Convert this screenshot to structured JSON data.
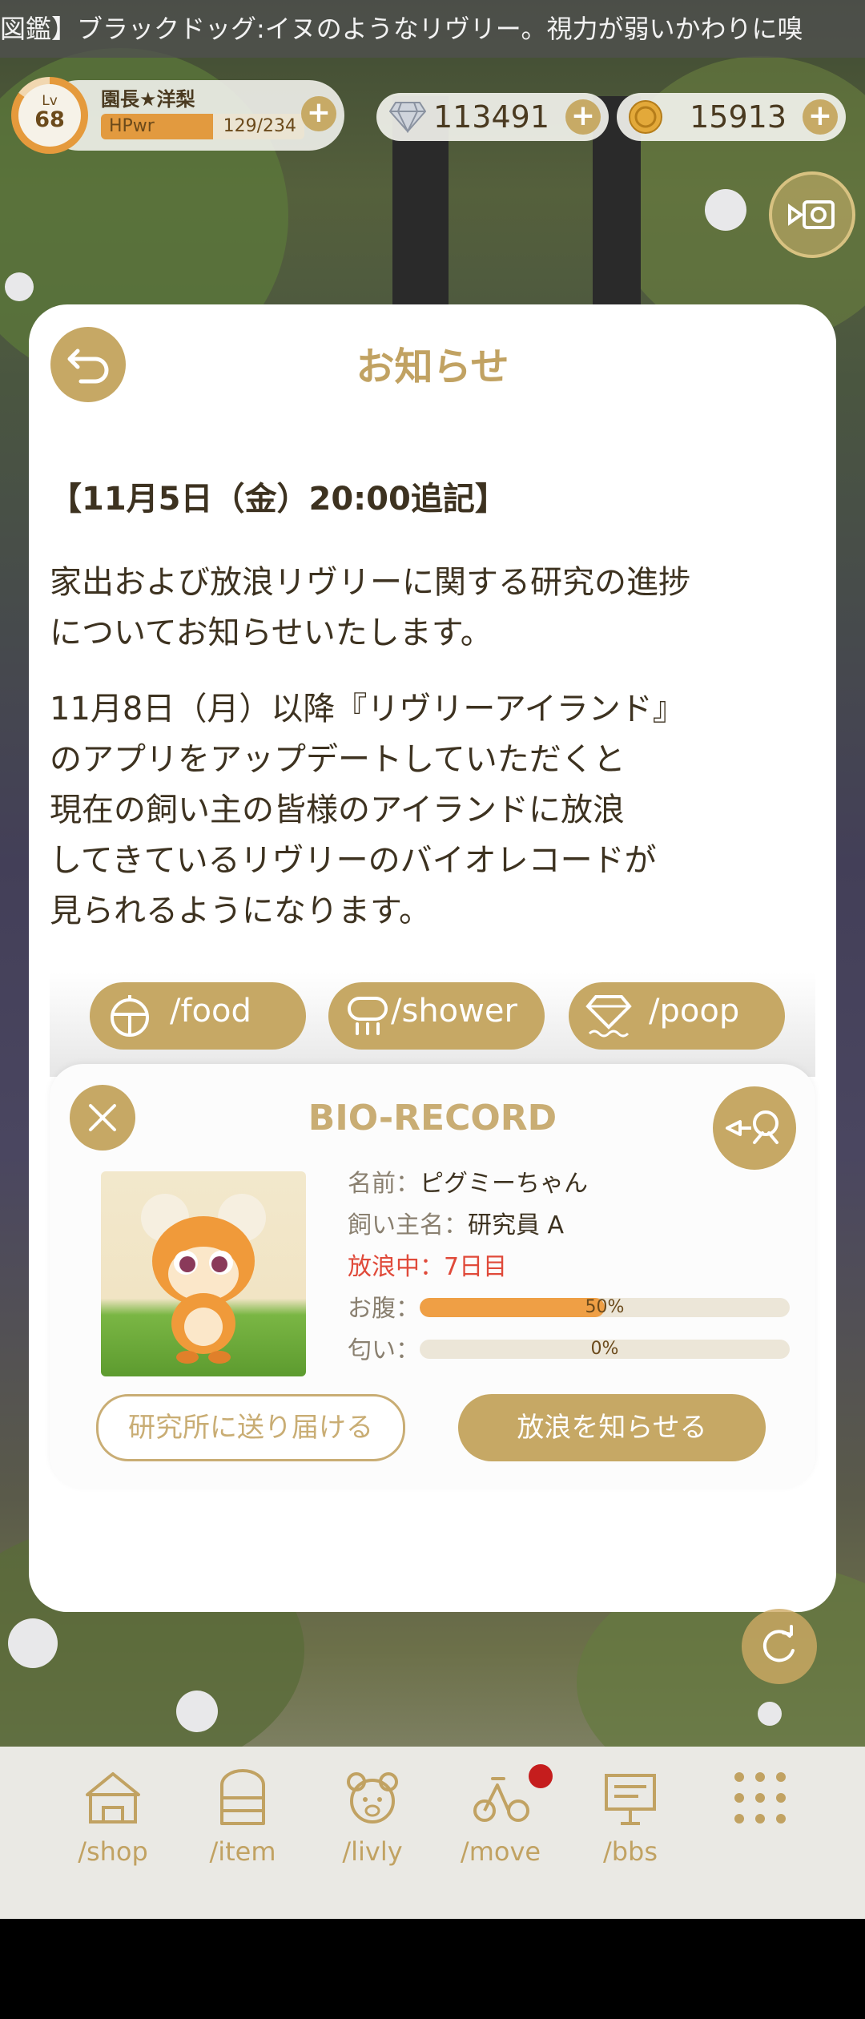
{
  "ticker": {
    "text": "図鑑】ブラックドッグ:イヌのようなリヴリー。視力が弱いかわりに嗅"
  },
  "player": {
    "level_label": "Lv",
    "level": "68",
    "name": "園長★洋梨",
    "hp_label": "HPwr",
    "hp_value": "129/234",
    "hp_fraction": 0.55
  },
  "currency": {
    "gems": "113491",
    "coins": "15913"
  },
  "modal": {
    "title": "お知らせ",
    "heading": "【11月5日（金）20:00追記】",
    "para1_line1": "家出および放浪リヴリーに関する研究の進捗",
    "para1_line2": "についてお知らせいたします。",
    "para2_line1": "11月8日（月）以降『リヴリーアイランド』",
    "para2_line2": "のアプリをアップデートしていただくと",
    "para2_line3": "現在の飼い主の皆様のアイランドに放浪",
    "para2_line4": "してきているリヴリーのバイオレコードが",
    "para2_line5": "見られるようになります。"
  },
  "actions": {
    "food": "/food",
    "shower": "/shower",
    "poop": "/poop"
  },
  "bio_record": {
    "title": "BIO-RECORD",
    "name_key": "名前：",
    "name_value": "ピグミーちゃん",
    "owner_key": "飼い主名：",
    "owner_value": "研究員 A",
    "status": "放浪中：7日目",
    "hunger_key": "お腹：",
    "hunger_pct_label": "50%",
    "hunger_fraction": 0.5,
    "smell_key": "匂い：",
    "smell_pct_label": "0%",
    "smell_fraction": 0,
    "send_button": "研究所に送り届ける",
    "notify_button": "放浪を知らせる"
  },
  "nav": [
    {
      "label": "/shop",
      "icon": "tent-icon"
    },
    {
      "label": "/item",
      "icon": "cabinet-icon"
    },
    {
      "label": "/livly",
      "icon": "bear-face-icon"
    },
    {
      "label": "/move",
      "icon": "bicycle-icon"
    },
    {
      "label": "/bbs",
      "icon": "signboard-icon"
    },
    {
      "label": "",
      "icon": "grid-dots-icon"
    }
  ],
  "colors": {
    "accent_gold": "#c6a865",
    "title_gold": "#c1a262",
    "status_red": "#e04a3a",
    "meter_orange": "#ef9f45",
    "badge_red": "#c51d1d"
  }
}
